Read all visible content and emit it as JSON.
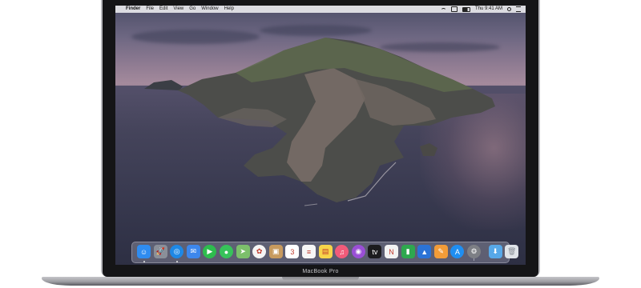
{
  "device": {
    "label": "MacBook Pro"
  },
  "menubar": {
    "apple_glyph": "",
    "items": [
      "Finder",
      "File",
      "Edit",
      "View",
      "Go",
      "Window",
      "Help"
    ],
    "clock": "Thu 9:41 AM"
  },
  "dock": {
    "apps": [
      {
        "name": "Finder",
        "icon": "finder-icon",
        "color": "#2f8cf0",
        "glyph": "☺"
      },
      {
        "name": "Launchpad",
        "icon": "launchpad-icon",
        "color": "#8a8f99",
        "glyph": "🚀"
      },
      {
        "name": "Safari",
        "icon": "safari-icon",
        "color": "#1e88e5",
        "glyph": "◎"
      },
      {
        "name": "Mail",
        "icon": "mail-icon",
        "color": "#3d87ec",
        "glyph": "✉"
      },
      {
        "name": "FaceTime",
        "icon": "facetime-icon",
        "color": "#2ebd4e",
        "glyph": "▶"
      },
      {
        "name": "Messages",
        "icon": "messages-icon",
        "color": "#37c25a",
        "glyph": "●"
      },
      {
        "name": "Maps",
        "icon": "maps-icon",
        "color": "#7cbf6b",
        "glyph": "➤"
      },
      {
        "name": "Photos",
        "icon": "photos-icon",
        "color": "#f4f4f4",
        "glyph": "✿"
      },
      {
        "name": "Contacts",
        "icon": "contacts-icon",
        "color": "#c79a5e",
        "glyph": "▣"
      },
      {
        "name": "Calendar",
        "icon": "calendar-icon",
        "color": "#ffffff",
        "glyph": "3"
      },
      {
        "name": "Reminders",
        "icon": "reminders-icon",
        "color": "#f6f6f6",
        "glyph": "≡"
      },
      {
        "name": "Notes",
        "icon": "notes-icon",
        "color": "#f7d54a",
        "glyph": "▤"
      },
      {
        "name": "Music",
        "icon": "music-icon",
        "color": "#f25b7a",
        "glyph": "♫"
      },
      {
        "name": "Podcasts",
        "icon": "podcasts-icon",
        "color": "#9a4fd6",
        "glyph": "◉"
      },
      {
        "name": "TV",
        "icon": "tv-icon",
        "color": "#1c1c1e",
        "glyph": "tv"
      },
      {
        "name": "News",
        "icon": "news-icon",
        "color": "#f2f2f2",
        "glyph": "N"
      },
      {
        "name": "Numbers",
        "icon": "numbers-icon",
        "color": "#2ea84e",
        "glyph": "▮"
      },
      {
        "name": "Keynote",
        "icon": "keynote-icon",
        "color": "#2b73d6",
        "glyph": "▲"
      },
      {
        "name": "Pages",
        "icon": "pages-icon",
        "color": "#f29c38",
        "glyph": "✎"
      },
      {
        "name": "App Store",
        "icon": "app-store-icon",
        "color": "#1f8ef1",
        "glyph": "A"
      },
      {
        "name": "System Preferences",
        "icon": "gear-icon",
        "color": "#7d7f85",
        "glyph": "⚙"
      },
      {
        "name": "Downloads",
        "icon": "folder-icon",
        "color": "#57a8e8",
        "glyph": "⬇"
      },
      {
        "name": "Trash",
        "icon": "trash-icon",
        "color": "#dfe3e8",
        "glyph": "🗑"
      }
    ]
  }
}
